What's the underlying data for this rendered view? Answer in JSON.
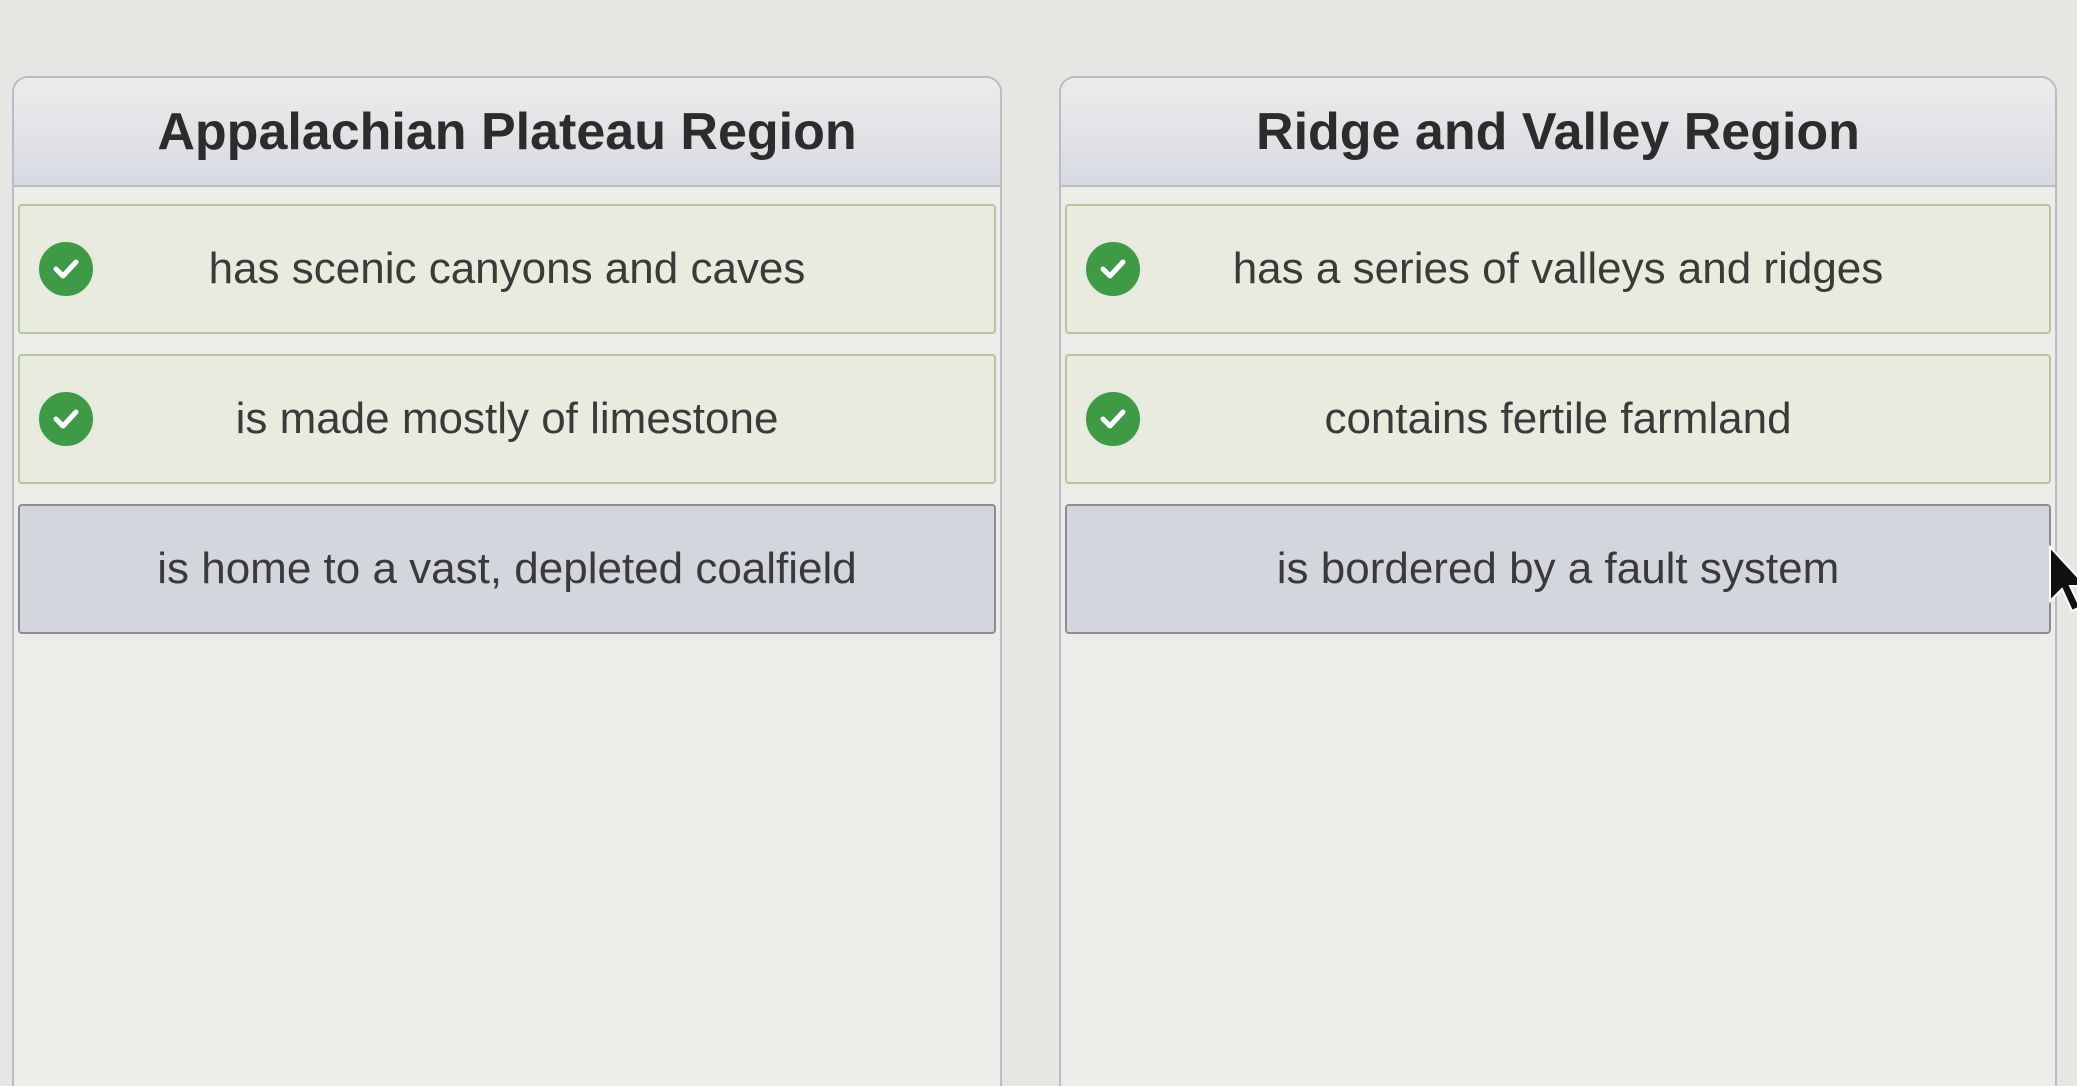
{
  "columns": [
    {
      "title": "Appalachian Plateau Region",
      "items": [
        {
          "text": "has scenic canyons and caves",
          "status": "correct"
        },
        {
          "text": "is made mostly of limestone",
          "status": "correct"
        },
        {
          "text": "is home to a vast, depleted coalfield",
          "status": "unchecked"
        }
      ]
    },
    {
      "title": "Ridge and Valley Region",
      "items": [
        {
          "text": "has a series of valleys and ridges",
          "status": "correct"
        },
        {
          "text": "contains fertile farmland",
          "status": "correct"
        },
        {
          "text": "is bordered by a fault system",
          "status": "unchecked"
        }
      ]
    }
  ],
  "icons": {
    "correct": "check-circle-icon",
    "pointer": "mouse-cursor-icon"
  },
  "colors": {
    "check_green": "#3f9a46",
    "correct_border": "#b2c89a",
    "header_bg": "#d7dae1"
  }
}
